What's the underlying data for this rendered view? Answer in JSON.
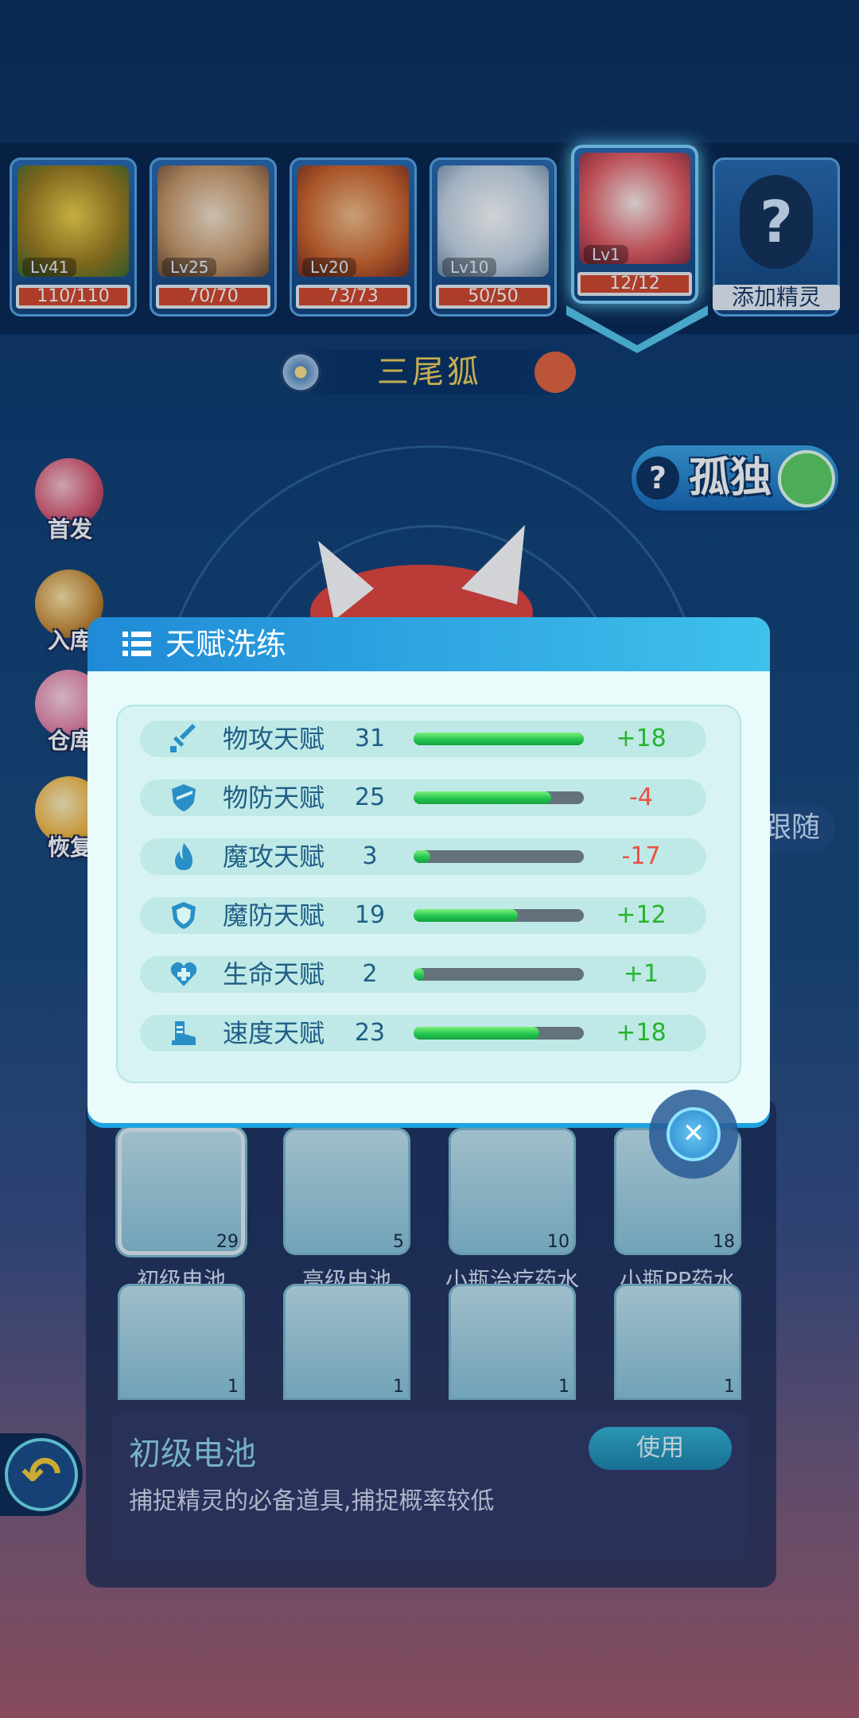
{
  "team": [
    {
      "level": "Lv41",
      "hp": "110/110",
      "color": "#e5b23b"
    },
    {
      "level": "Lv25",
      "hp": "70/70",
      "color": "#d8a072"
    },
    {
      "level": "Lv20",
      "hp": "73/73",
      "color": "#e07a3c"
    },
    {
      "level": "Lv10",
      "hp": "50/50",
      "color": "#bfd3e4"
    },
    {
      "level": "Lv1",
      "hp": "12/12",
      "color": "#e55c62",
      "active": true
    }
  ],
  "add_slot": {
    "icon": "question-mark-icon",
    "label": "添加精灵"
  },
  "pet_name": "三尾狐",
  "personality": {
    "help": "?",
    "label": "孤独",
    "icon": "refresh-icon"
  },
  "side_menu": [
    "首发",
    "入库",
    "仓库",
    "恢复"
  ],
  "follow_label": "跟随",
  "modal": {
    "title": "天赋洗练",
    "rows": [
      {
        "icon": "sword-icon",
        "label": "物攻天赋",
        "value": "31",
        "bar": 1.0,
        "delta": "+18",
        "positive": true
      },
      {
        "icon": "shield-icon",
        "label": "物防天赋",
        "value": "25",
        "bar": 0.81,
        "delta": "-4",
        "positive": false
      },
      {
        "icon": "flame-icon",
        "label": "魔攻天赋",
        "value": "3",
        "bar": 0.1,
        "delta": "-17",
        "positive": false
      },
      {
        "icon": "magic-shield-icon",
        "label": "魔防天赋",
        "value": "19",
        "bar": 0.61,
        "delta": "+12",
        "positive": true
      },
      {
        "icon": "heart-plus-icon",
        "label": "生命天赋",
        "value": "2",
        "bar": 0.06,
        "delta": "+1",
        "positive": true
      },
      {
        "icon": "boot-icon",
        "label": "速度天赋",
        "value": "23",
        "bar": 0.74,
        "delta": "+18",
        "positive": true
      }
    ],
    "close_icon": "close-icon"
  },
  "inventory": {
    "items": [
      {
        "name": "初级电池",
        "count": "29",
        "icon": "battery-icon"
      },
      {
        "name": "高级电池",
        "count": "5",
        "icon": "advanced-battery-icon"
      },
      {
        "name": "小瓶治疗药水",
        "count": "10",
        "icon": "red-potion-icon"
      },
      {
        "name": "小瓶PP药水",
        "count": "18",
        "icon": "pp-potion-icon"
      },
      {
        "name": "",
        "count": "1",
        "icon": "red-flask-icon"
      },
      {
        "name": "",
        "count": "1",
        "icon": "blue-p-potion-icon"
      },
      {
        "name": "",
        "count": "1",
        "icon": "gold-battery-icon"
      },
      {
        "name": "",
        "count": "1",
        "icon": "green-fruit-icon"
      }
    ],
    "selected_title": "初级电池",
    "selected_desc": "捕捉精灵的必备道具,捕捉概率较低",
    "use_label": "使用"
  }
}
